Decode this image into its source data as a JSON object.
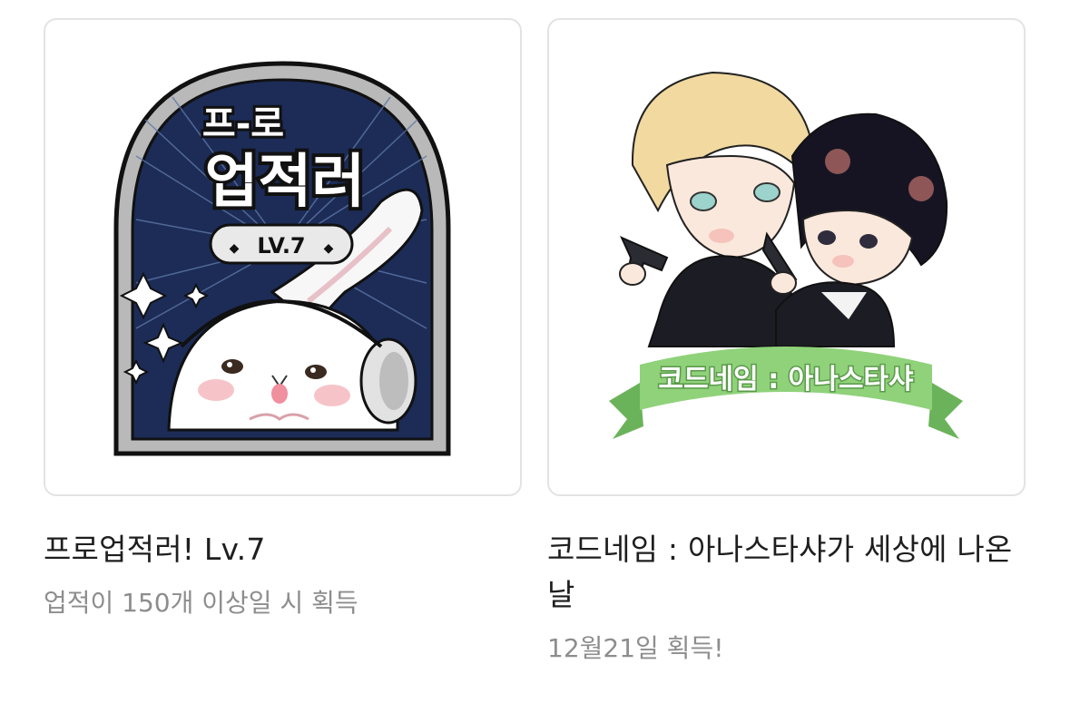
{
  "cards": [
    {
      "title": "프로업적러! Lv.7",
      "subtitle": "업적이 150개 이상일 시 획득",
      "badge": {
        "line1": "프-로",
        "line2": "업적러",
        "level": "LV.7",
        "colors": {
          "navy": "#1c2c57",
          "frame": "#b9b9b9",
          "outline": "#111111"
        }
      }
    },
    {
      "title": "코드네임 : 아나스타샤가 세상에 나온 날",
      "subtitle": "12월21일 획득!",
      "badge": {
        "ribbon_text": "코드네임 : 아나스타샤",
        "colors": {
          "ribbon": "#8fd27a",
          "ribbon_dark": "#6bb35a",
          "blonde": "#f1d9a0",
          "dark_hair": "#161423",
          "suit": "#1c1c24"
        }
      }
    }
  ]
}
